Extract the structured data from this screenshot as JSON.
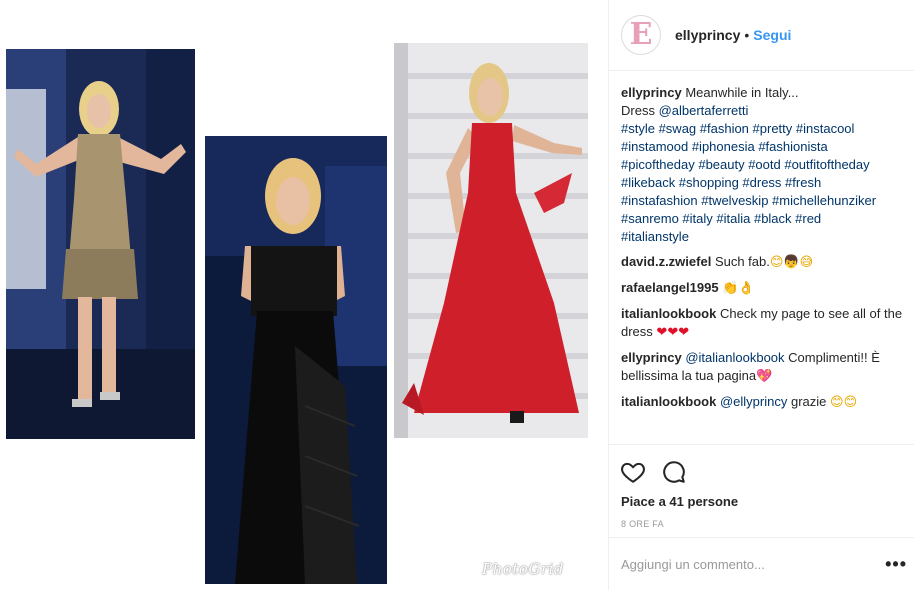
{
  "header": {
    "avatar_letter": "E",
    "username": "ellyprincy",
    "separator": "•",
    "follow_label": "Segui"
  },
  "caption": {
    "username": "ellyprincy",
    "text_line1": "Meanwhile in Italy...",
    "dress_prefix": "Dress",
    "dress_mention": "@albertaferretti",
    "hashtag_lines": [
      "#style #swag #fashion #pretty #instacool",
      "#instamood #iphonesia #fashionista",
      "#picoftheday #beauty #ootd #outfitoftheday",
      "#likeback #shopping #dress #fresh",
      "#instafashion #twelveskip #michellehunziker",
      "#sanremo #italy #italia #black #red",
      "#italianstyle"
    ]
  },
  "comments": [
    {
      "user": "david.z.zwiefel",
      "text": "Such fab.",
      "emojis": "😊👦😅"
    },
    {
      "user": "rafaelangel1995",
      "text": "",
      "emojis": "👏👌"
    },
    {
      "user": "italianlookbook",
      "text": "Check my page to see all of the dress",
      "emojis": "❤❤❤"
    },
    {
      "user": "ellyprincy",
      "mention": "@italianlookbook",
      "text": "Complimenti!! È bellissima la tua pagina",
      "emojis": "💖"
    },
    {
      "user": "italianlookbook",
      "mention": "@ellyprincy",
      "text": "grazie",
      "emojis": "😊😊"
    }
  ],
  "actions": {
    "like_icon": "heart-outline-icon",
    "comment_icon": "speech-bubble-icon",
    "likes_text": "Piace a 41 persone",
    "time_text": "8 ORE FA"
  },
  "add_comment": {
    "placeholder": "Aggiungi un commento...",
    "more_label": "•••"
  },
  "media": {
    "watermark": "PhotoGrid"
  },
  "colors": {
    "link_blue": "#3897f0",
    "hashtag_navy": "#003569",
    "border": "#efefef",
    "muted": "#999999"
  }
}
